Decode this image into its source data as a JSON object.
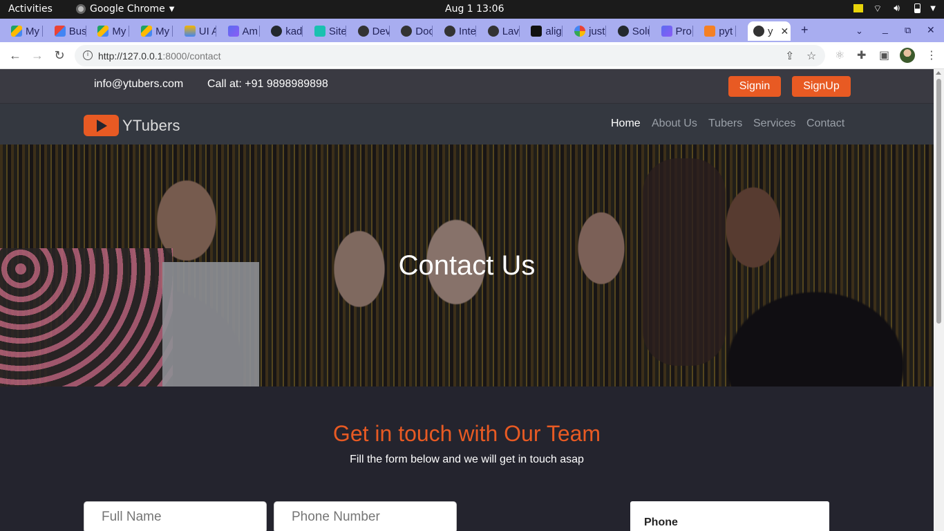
{
  "os": {
    "activities": "Activities",
    "app_name": "Google Chrome",
    "clock": "Aug 1  13:06"
  },
  "browser": {
    "tabs": [
      {
        "label": "My",
        "icon": "drive-icon"
      },
      {
        "label": "Bus",
        "icon": "gmail-icon"
      },
      {
        "label": "My",
        "icon": "drive-icon"
      },
      {
        "label": "My",
        "icon": "drive-icon"
      },
      {
        "label": "UI A",
        "icon": "w-icon"
      },
      {
        "label": "Am",
        "icon": "workflow-icon"
      },
      {
        "label": "kad",
        "icon": "github-icon"
      },
      {
        "label": "Site",
        "icon": "diamond-icon"
      },
      {
        "label": "Dev",
        "icon": "globe-icon"
      },
      {
        "label": "Doc",
        "icon": "globe-icon"
      },
      {
        "label": "Inte",
        "icon": "globe-icon"
      },
      {
        "label": "Lav",
        "icon": "globe-icon"
      },
      {
        "label": "alig",
        "icon": "m-icon"
      },
      {
        "label": "just",
        "icon": "google-icon"
      },
      {
        "label": "Solu",
        "icon": "github-icon"
      },
      {
        "label": "Pro",
        "icon": "workflow-icon"
      },
      {
        "label": "pyt",
        "icon": "stack-icon"
      },
      {
        "label": "y",
        "icon": "globe-icon",
        "active": true
      }
    ],
    "url_host": "http://127.0.0.1",
    "url_rest": ":8000/contact"
  },
  "site": {
    "email": "info@ytubers.com",
    "phone": "Call at: +91 9898989898",
    "signin": "Signin",
    "signup": "SignUp",
    "brand": "YTubers",
    "menu": [
      "Home",
      "About Us",
      "Tubers",
      "Services",
      "Contact"
    ],
    "hero_title": "Contact Us",
    "section_heading": "Get in touch with Our Team",
    "section_sub": "Fill the form below and we will get in touch asap",
    "form": {
      "full_name_placeholder": "Full Name",
      "phone_placeholder": "Phone Number"
    },
    "card_label": "Phone",
    "accent_color": "#e85a23"
  }
}
